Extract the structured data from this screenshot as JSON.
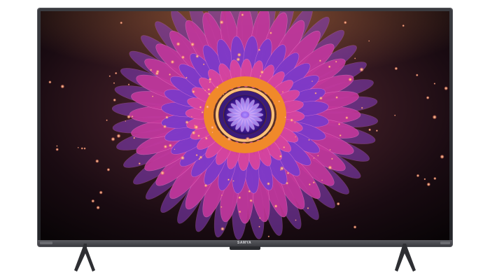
{
  "product": {
    "brand_logo": "SAMYA",
    "type": "flat-screen-television",
    "frame_color": "#2b2c30",
    "screen_artwork": "glowing-flower-fractal",
    "artwork_colors": {
      "outer_petals": "#c2379b",
      "violet_petals": "#7d3ac9",
      "orange_ring": "#f0892a",
      "center": "#5a2bd1",
      "glow": "#ffb36b"
    }
  }
}
